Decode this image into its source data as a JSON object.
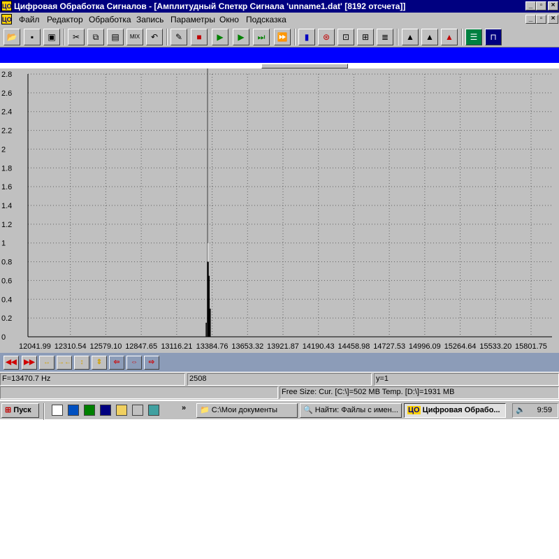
{
  "window": {
    "title": "Цифровая Обработка Сигналов - [Амплитудный Спеткр Сигнала 'unname1.dat' [8192 отсчета]]",
    "app_icon_text": "ЦО"
  },
  "menu": {
    "items": [
      "Файл",
      "Редактор",
      "Обработка",
      "Запись",
      "Параметры",
      "Окно",
      "Подсказка"
    ]
  },
  "toolbar": {
    "buttons": [
      "open-icon",
      "save-icon",
      "save-all-icon",
      "cut-icon",
      "copy-icon",
      "paste-icon",
      "mix-icon",
      "undo-icon",
      "edit-pen-icon",
      "stop-icon",
      "play-icon",
      "play-step-icon",
      "play-end-icon",
      "play-loop-icon",
      "spectrum-icon",
      "signal-icon",
      "filter1-icon",
      "filter2-icon",
      "filter3-icon",
      "wave1-icon",
      "wave2-icon",
      "wave3-icon",
      "record-icon",
      "oscilloscope-icon"
    ]
  },
  "chart_data": {
    "type": "line",
    "ylim": [
      0,
      2.8
    ],
    "y_ticks": [
      "0",
      "0.2",
      "0.4",
      "0.6",
      "0.8",
      "1",
      "1.2",
      "1.4",
      "1.6",
      "1.8",
      "2",
      "2.2",
      "2.4",
      "2.6",
      "2.8"
    ],
    "x_ticks": [
      "12041.99",
      "12310.54",
      "12579.10",
      "12847.65",
      "13116.21",
      "13384.76",
      "13653.32",
      "13921.87",
      "14190.43",
      "14458.98",
      "14727.53",
      "14996.09",
      "15264.64",
      "15533.20",
      "15801.75"
    ],
    "grid": true,
    "cursor_x": 13350,
    "peak": {
      "x": 13355,
      "y": 1.0
    },
    "spikes": [
      {
        "x": 13340,
        "y": 0.15
      },
      {
        "x": 13350,
        "y": 0.8
      },
      {
        "x": 13355,
        "y": 1.0
      },
      {
        "x": 13362,
        "y": 0.65
      },
      {
        "x": 13370,
        "y": 0.3
      }
    ]
  },
  "nav_buttons": [
    "scroll-left-fast-icon",
    "scroll-left-icon",
    "zoom-x-in-icon",
    "zoom-x-out-icon",
    "zoom-y-in-icon",
    "zoom-y-out-icon",
    "shift-left-icon",
    "shift-mid-icon",
    "shift-right-icon"
  ],
  "status": {
    "frequency": "F=13470.7 Hz",
    "index": "2508",
    "y_value": "y=1",
    "free_size": "Free Size: Cur. [C:\\]=502 MB Temp. [D:\\]=1931 MB"
  },
  "taskbar": {
    "start_label": "Пуск",
    "tasks": [
      "C:\\Мои документы",
      "Найти: Файлы с имен...",
      "Цифровая Обрабо..."
    ],
    "clock": "9:59",
    "overflow": "»"
  }
}
